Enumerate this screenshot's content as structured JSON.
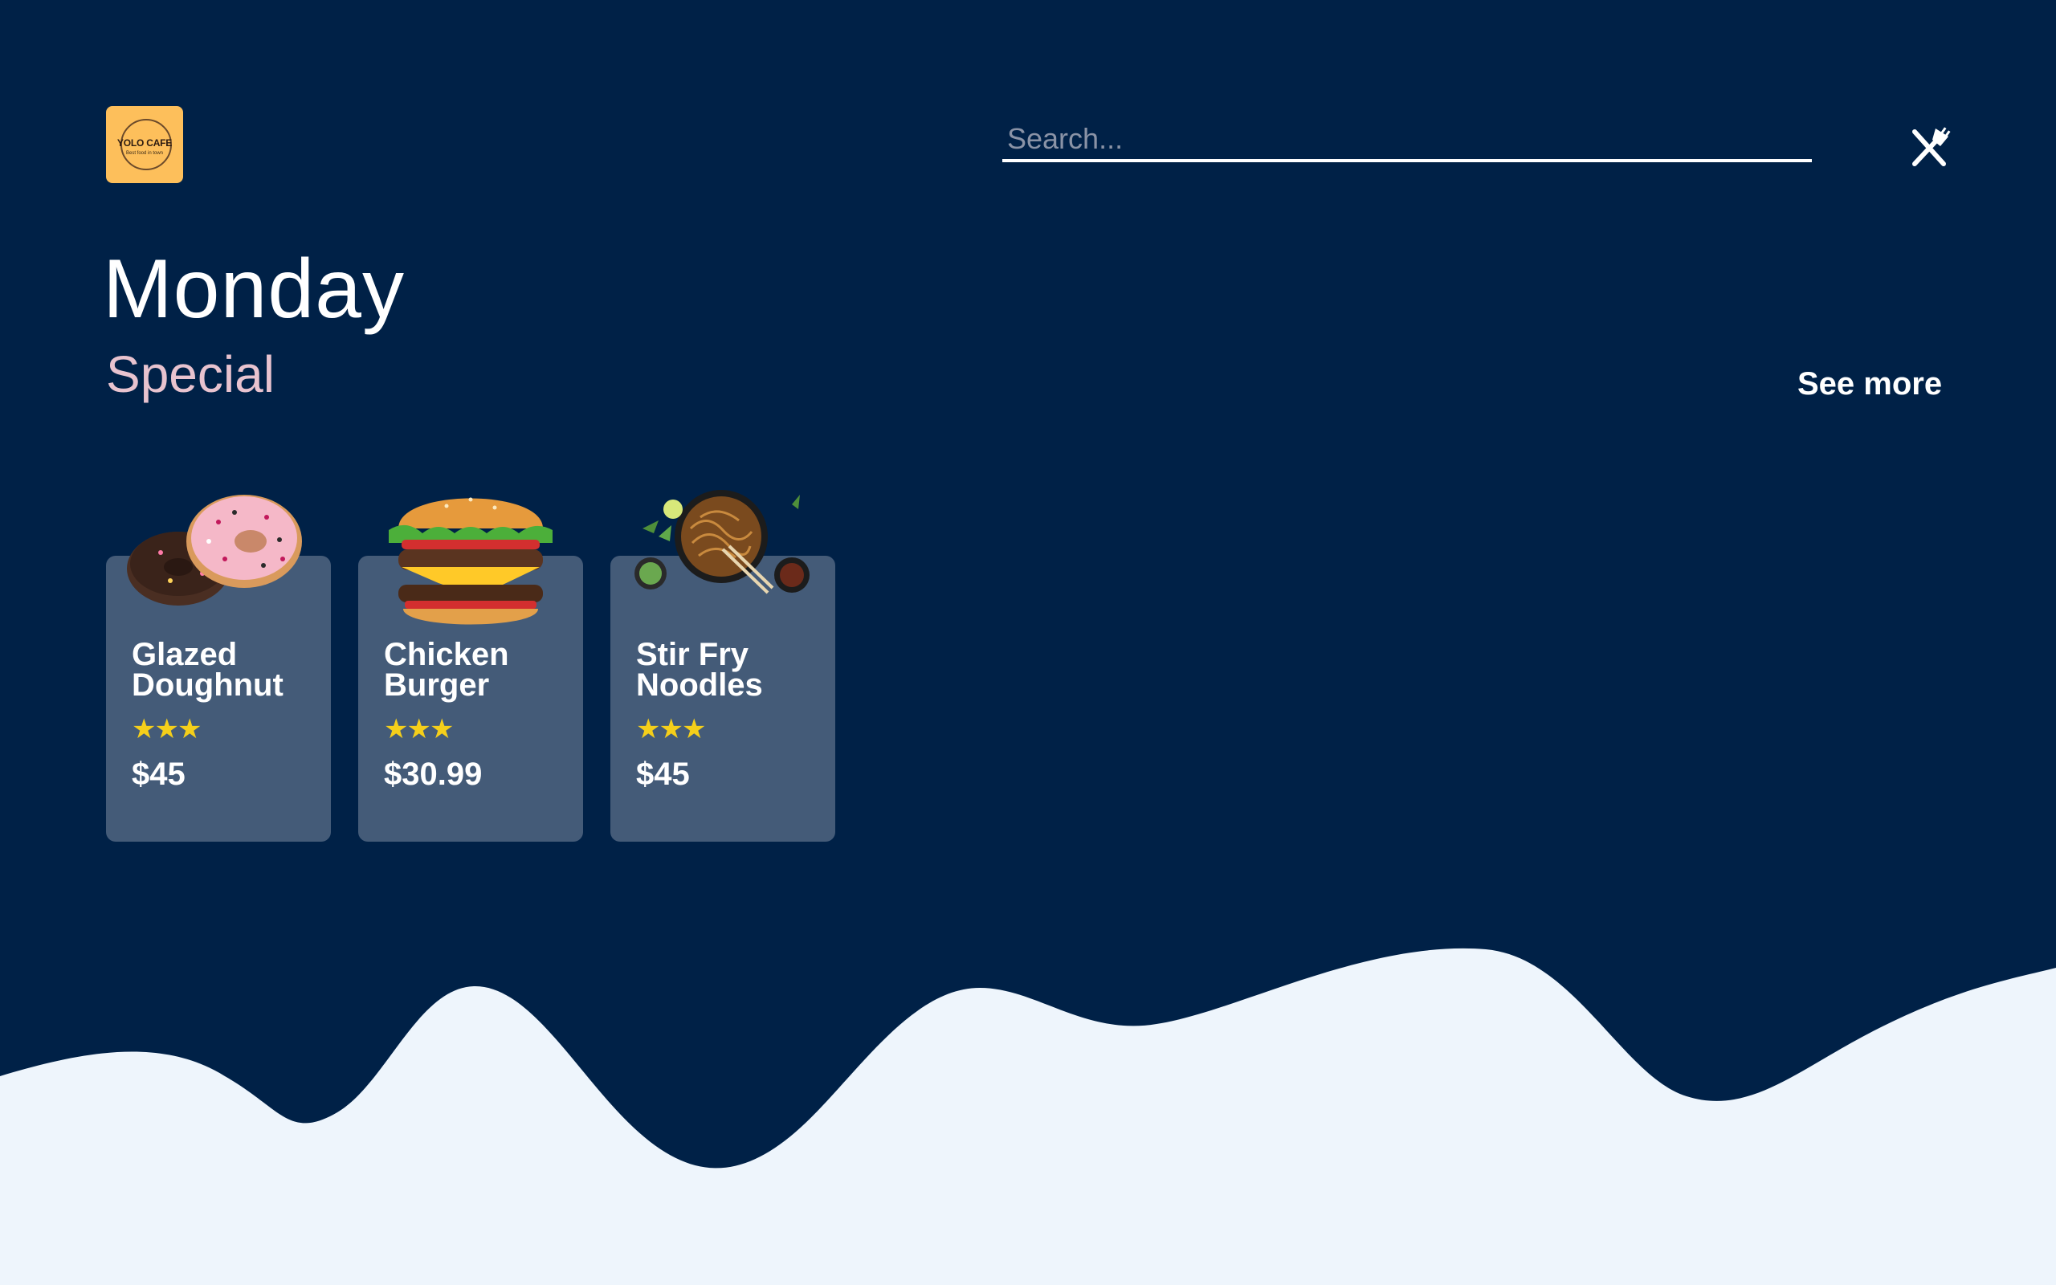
{
  "logo": {
    "text": "YOLO CAFE",
    "subtext": "Best food in town"
  },
  "search": {
    "placeholder": "Search..."
  },
  "header": {
    "menu_icon": "utensils-icon"
  },
  "section": {
    "title": "Monday",
    "subtitle": "Special",
    "see_more": "See more"
  },
  "cards": [
    {
      "name_line1": "Glazed",
      "name_line2": "Doughnut",
      "rating": 3,
      "rating_display": "★★★",
      "price": "$45",
      "image": "doughnut-image"
    },
    {
      "name_line1": "Chicken",
      "name_line2": "Burger",
      "rating": 3,
      "rating_display": "★★★",
      "price": "$30.99",
      "image": "burger-image"
    },
    {
      "name_line1": "Stir Fry",
      "name_line2": "Noodles",
      "rating": 3,
      "rating_display": "★★★",
      "price": "$45",
      "image": "noodles-image"
    }
  ],
  "colors": {
    "background": "#002147",
    "wave": "#eef5fc",
    "card": "#445b78",
    "accent": "#fdbf5b",
    "subtitle": "#e8c3cf",
    "star": "#f5cf1a"
  }
}
